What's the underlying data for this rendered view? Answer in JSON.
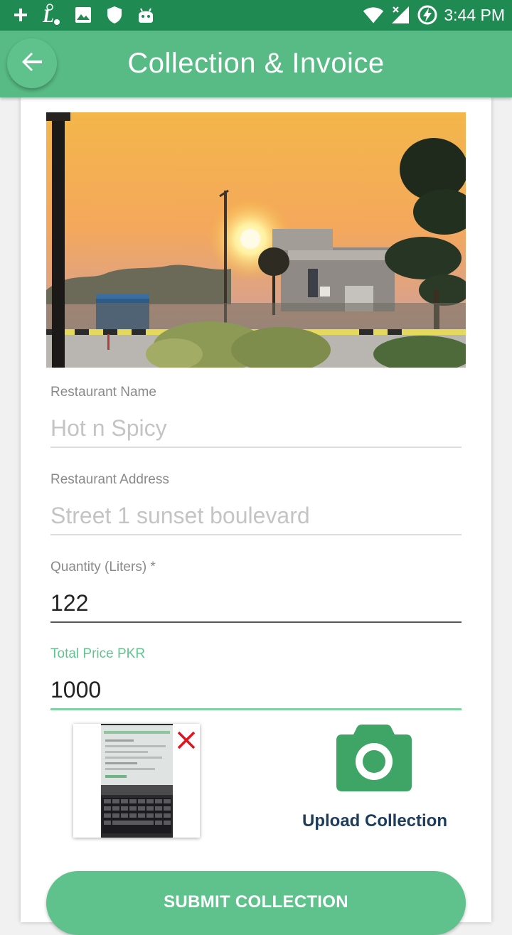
{
  "status_bar": {
    "time": "3:44 PM",
    "icons_left": [
      "plus-icon",
      "app-l-icon",
      "image-icon",
      "shield-icon",
      "android-icon"
    ],
    "icons_right": [
      "wifi-icon",
      "signal-icon",
      "battery-charging-icon"
    ]
  },
  "app_bar": {
    "title": "Collection & Invoice",
    "back_icon": "arrow-back-icon"
  },
  "form": {
    "restaurant_name": {
      "label": "Restaurant Name",
      "value": "Hot n Spicy"
    },
    "restaurant_address": {
      "label": "Restaurant Address",
      "value": "Street 1 sunset boulevard"
    },
    "quantity": {
      "label": "Quantity (Liters) *",
      "value": "122"
    },
    "total_price": {
      "label": "Total Price PKR",
      "value": "1000"
    }
  },
  "attachment": {
    "remove_icon": "close-icon"
  },
  "upload": {
    "label": "Upload Collection",
    "icon": "camera-icon"
  },
  "submit": {
    "label": "SUBMIT COLLECTION"
  },
  "colors": {
    "status_bar": "#1f8a52",
    "app_bar": "#58bb85",
    "accent": "#5fc28c",
    "camera": "#3ea566",
    "upload_label": "#1c3c5c",
    "remove": "#e0141e"
  }
}
